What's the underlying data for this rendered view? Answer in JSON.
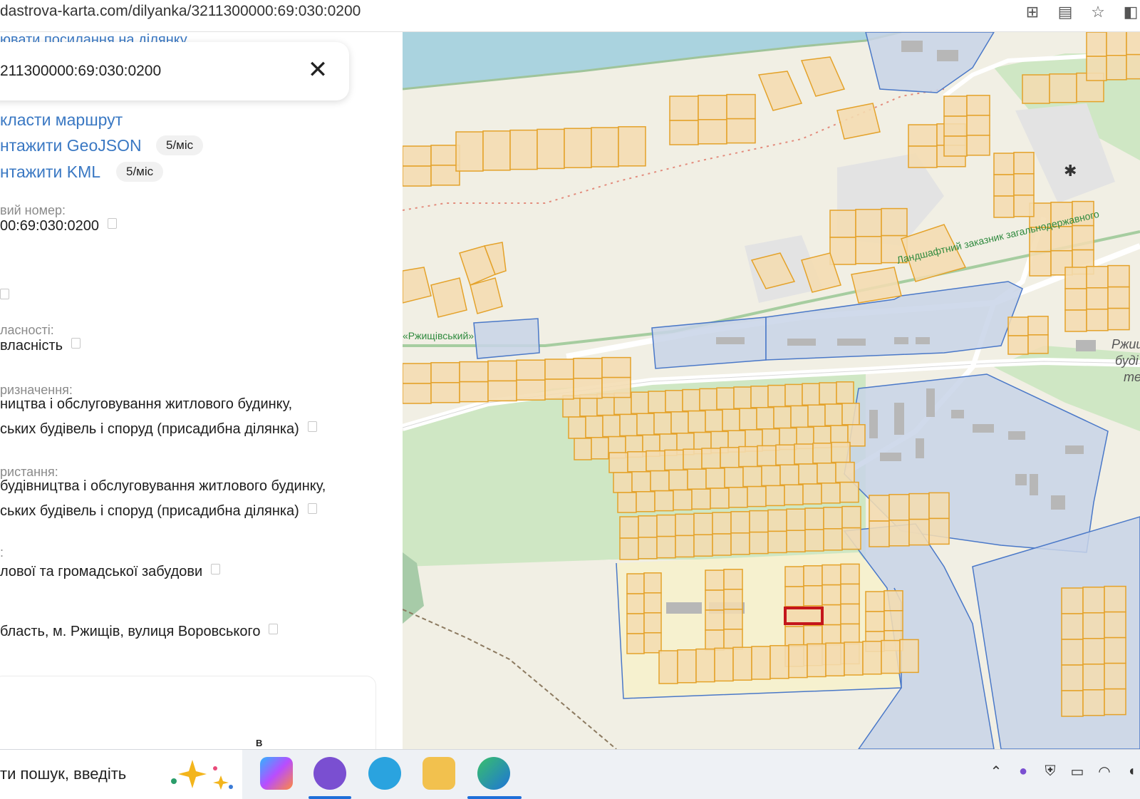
{
  "browser": {
    "url": "dastrova-karta.com/dilyanka/3211300000:69:030:0200",
    "icons": [
      "split-screen-icon",
      "reader-icon",
      "star-icon",
      "extensions-icon"
    ]
  },
  "panel": {
    "partial_link": "ювати посилання на ділянку",
    "search": {
      "value": "211300000:69:030:0200"
    },
    "actions": [
      {
        "label": "класти маршрут"
      },
      {
        "label": "нтажити GeoJSON",
        "badge": "5/міс"
      },
      {
        "label": "нтажити KML",
        "badge": "5/міс"
      }
    ],
    "fields": [
      {
        "label": "вий номер:",
        "lines": [
          "00:69:030:0200"
        ]
      },
      {
        "label": "ласності:",
        "lines": [
          "власність"
        ]
      },
      {
        "label": "ризначення:",
        "lines": [
          "ництва і обслуговування житлового будинку,",
          "ських будівель і споруд (присадибна ділянка)"
        ]
      },
      {
        "label": "ристання:",
        "lines": [
          "будівництва і обслуговування житлового будинку,",
          "ських будівель і споруд (присадибна ділянка)"
        ]
      },
      {
        "label": ":",
        "lines": [
          "лової та громадської забудови"
        ]
      },
      {
        "label": "",
        "lines": [
          "бласть, м. Ржищів, вулиця Воровського"
        ]
      }
    ],
    "card": {
      "label": "B"
    }
  },
  "map": {
    "labels": {
      "reserve": "Ландшафтний заказник загальнодержавного",
      "reserve_short": "«Ржищівський»",
      "town_1": "Ржищ",
      "town_2": "буді",
      "town_3": "те"
    },
    "colors": {
      "parcel_fill": "#f4dcb0",
      "parcel_stroke": "#e4a22a",
      "state_fill": "#c8d3e8",
      "state_stroke": "#4a78c8",
      "selected_stroke": "#c4161c",
      "water": "#aad3df",
      "forest": "#cfe7c4",
      "sand": "#f1efe4"
    }
  },
  "taskbar": {
    "search_text": "ти пошук, введіть",
    "apps": [
      "copilot-icon",
      "viber-icon",
      "telegram-icon",
      "file-explorer-icon",
      "edge-icon"
    ],
    "tray": [
      "chevron-up-icon",
      "viber-tray-icon",
      "security-icon",
      "battery-icon",
      "wifi-icon",
      "volume-icon"
    ]
  }
}
